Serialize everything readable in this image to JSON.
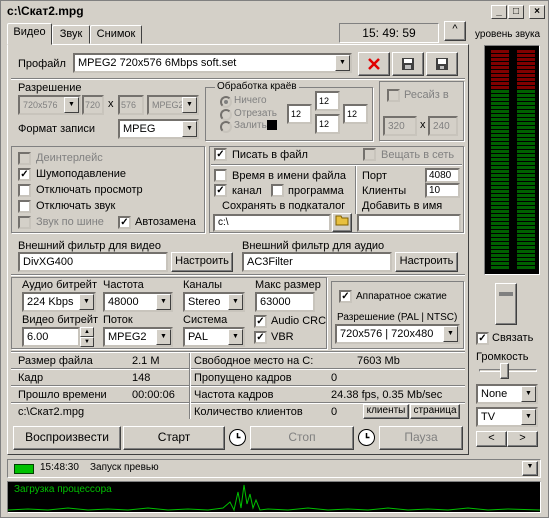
{
  "window": {
    "title": "c:\\Скат2.mpg",
    "minimize": "_",
    "maximize": "□",
    "close": "×"
  },
  "tabs": [
    {
      "label": "Видео"
    },
    {
      "label": "Звук"
    },
    {
      "label": "Снимок"
    }
  ],
  "clock": "15: 49: 59",
  "collapse_btn": "^",
  "profile": {
    "label": "Профайл",
    "value": "MPEG2 720x576 6Mbps soft.set"
  },
  "resolution": {
    "label": "Разрешение",
    "preset": "720x576",
    "width": "720",
    "x": "x",
    "height": "576",
    "standard": "MPEG2"
  },
  "record_format": {
    "label": "Формат записи",
    "value": "MPEG"
  },
  "edge": {
    "title": "Обработка краёв",
    "options": [
      "Ничего",
      "Отрезать",
      "Залить"
    ],
    "values": [
      "12",
      "12",
      "12",
      "12"
    ]
  },
  "resize": {
    "label": "Ресайз в",
    "width": "320",
    "x": "x",
    "height": "240"
  },
  "video_opts": {
    "deinterlace": "Деинтерлейс",
    "denoise": "Шумоподавление",
    "no_preview": "Отключать просмотр",
    "no_sound": "Отключать звук",
    "bus_sound": "Звук по шине",
    "autoreplace": "Автозамена"
  },
  "output": {
    "write_file": "Писать в файл",
    "broadcast": "Вещать в сеть",
    "time_in_name": "Время в имени файла",
    "channel": "канал",
    "program": "программа",
    "save_subdir": "Сохранять в подкаталог",
    "path": "c:\\",
    "port_label": "Порт",
    "port": "4080",
    "clients_label": "Клиенты",
    "clients": "10",
    "add_to_name": "Добавить в имя"
  },
  "filters": {
    "video_label": "Внешний фильтр для видео",
    "video_value": "DivXG400",
    "audio_label": "Внешний фильтр для аудио",
    "audio_value": "AC3Filter",
    "configure": "Настроить"
  },
  "encode": {
    "audio_bitrate_label": "Аудио битрейт",
    "audio_bitrate": "224 Kbps",
    "freq_label": "Частота",
    "freq": "48000",
    "channels_label": "Каналы",
    "channels": "Stereo",
    "max_size_label": "Макс размер",
    "max_size": "63000",
    "video_bitrate_label": "Видео битрейт",
    "video_bitrate": "6.00",
    "stream_label": "Поток",
    "stream": "MPEG2",
    "system_label": "Система",
    "system": "PAL",
    "audio_crc": "Audio CRC",
    "vbr": "VBR"
  },
  "hw": {
    "compress": "Аппаратное сжатие",
    "res_label": "Разрешение (PAL | NTSC)",
    "res_value": "720x576 | 720x480"
  },
  "stats": {
    "file_size_label": "Размер файла",
    "file_size": "2.1 M",
    "free_label": "Свободное место на C:",
    "free": "7603 Mb",
    "frame_label": "Кадр",
    "frame": "148",
    "skipped_label": "Пропущено кадров",
    "skipped": "0",
    "elapsed_label": "Прошло времени",
    "elapsed": "00:00:06",
    "lost_label": "Потеряно кадров",
    "lost": "0",
    "frame_rate_label": "Частота кадров",
    "frame_rate": "24.38 fps, 0.35 Mb/sec",
    "file_path": "c:\\Скат2.mpg",
    "client_count_label": "Количество клиентов",
    "client_count": "0",
    "clients_btn": "клиенты",
    "page_btn": "страница"
  },
  "controls": {
    "play": "Воспроизвести",
    "start": "Старт",
    "stop": "Стоп",
    "pause": "Пауза"
  },
  "right": {
    "sound_level": "уровень звука",
    "link": "Связать",
    "volume": "Громкость",
    "combo1": "None",
    "combo2": "TV",
    "left": "<",
    "right": ">"
  },
  "status": {
    "time": "15:48:30",
    "text": "Запуск превью"
  },
  "cpu": {
    "label": "Загрузка процессора",
    "color": "#00c000"
  }
}
